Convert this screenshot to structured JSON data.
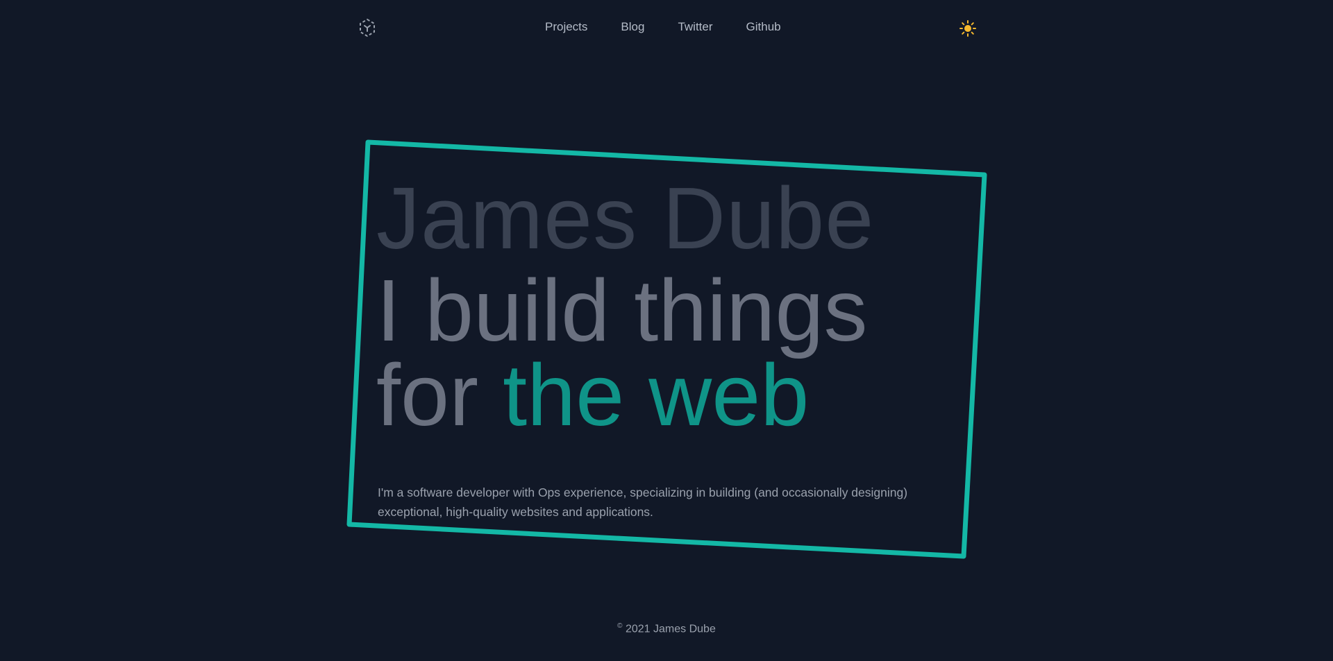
{
  "header": {
    "logo_icon": "hexagon-logo-icon",
    "nav": [
      {
        "label": "Projects"
      },
      {
        "label": "Blog"
      },
      {
        "label": "Twitter"
      },
      {
        "label": "Github"
      }
    ],
    "theme_icon": "sun-icon"
  },
  "hero": {
    "name": "James Dube",
    "tagline_line1": "I build things",
    "tagline_line2_prefix": "for ",
    "tagline_line2_accent": "the web",
    "intro": "I'm a software developer with Ops experience, specializing in building (and occasionally designing) exceptional, high-quality websites and applications."
  },
  "footer": {
    "copyright_symbol": "©",
    "text": " 2021 James Dube"
  },
  "colors": {
    "background": "#111827",
    "accent": "#14b8a6",
    "accent_text": "#0f9488",
    "sun": "#f5b82e"
  }
}
